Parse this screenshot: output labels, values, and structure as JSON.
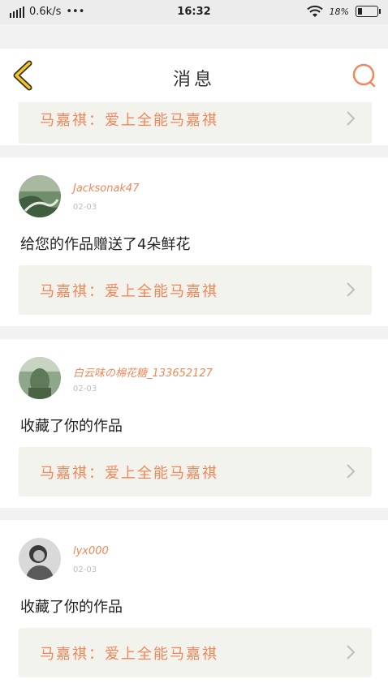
{
  "status_bar": {
    "speed": "0.6k/s",
    "dots": "•••",
    "time": "16:32",
    "battery_percent": "18%"
  },
  "nav": {
    "title": "消息",
    "back_icon": "chevron-left-icon",
    "search_icon": "search-icon"
  },
  "accent_color": "#f0875a",
  "work_chevron_icon": "chevron-right-icon",
  "notifications": [
    {
      "work_title": "马嘉祺：爱上全能马嘉祺"
    },
    {
      "username": "Jacksonak47",
      "date": "02-03",
      "message": "给您的作品赠送了4朵鲜花",
      "work_title": "马嘉祺：爱上全能马嘉祺"
    },
    {
      "username": "白云味の棉花糖_133652127",
      "date": "02-03",
      "message": "收藏了你的作品",
      "work_title": "马嘉祺：爱上全能马嘉祺"
    },
    {
      "username": "lyx000",
      "date": "02-03",
      "message": "收藏了你的作品",
      "work_title": "马嘉祺：爱上全能马嘉祺"
    }
  ]
}
